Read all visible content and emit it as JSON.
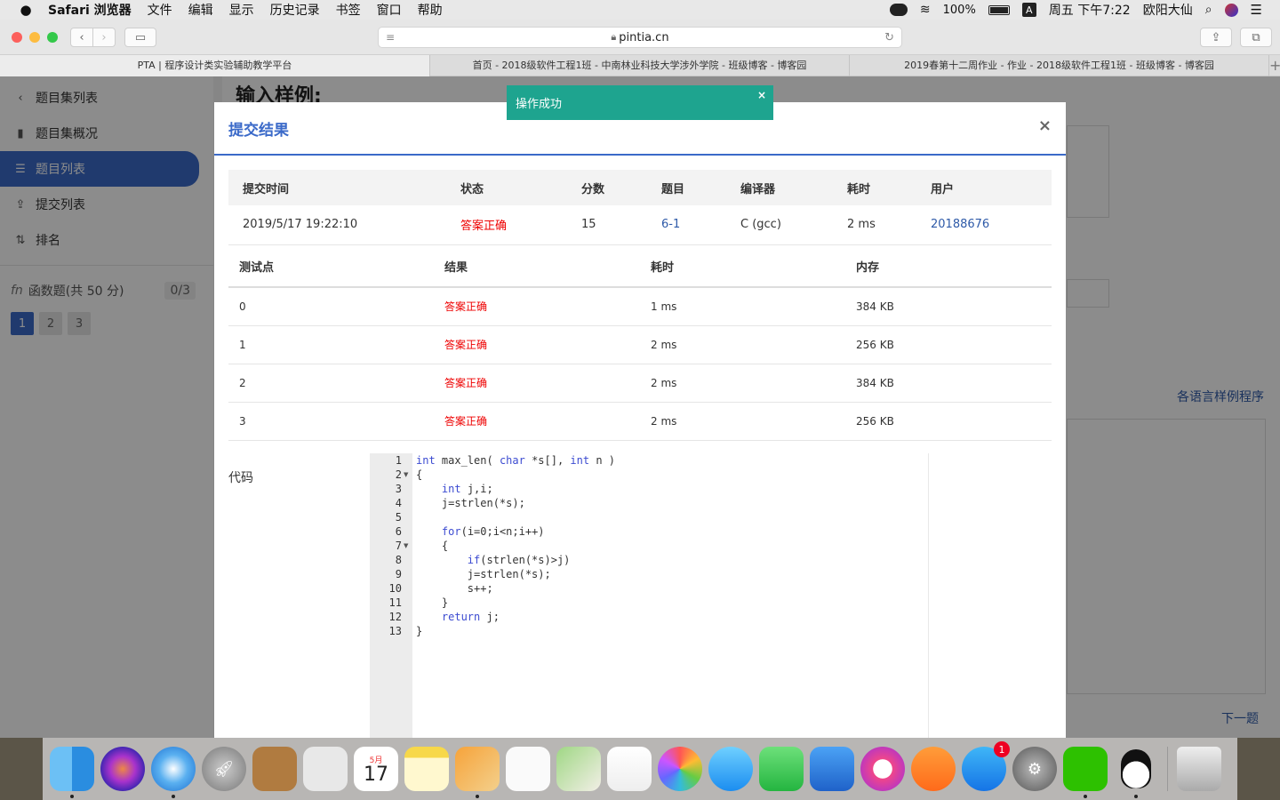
{
  "menubar": {
    "app": "Safari 浏览器",
    "items": [
      "文件",
      "编辑",
      "显示",
      "历史记录",
      "书签",
      "窗口",
      "帮助"
    ],
    "battery": "100%",
    "input_method": "A",
    "clock": "周五 下午7:22",
    "user": "欧阳大仙"
  },
  "toolbar": {
    "url": "pintia.cn"
  },
  "tabs": [
    "PTA | 程序设计类实验辅助教学平台",
    "首页 - 2018级软件工程1班 - 中南林业科技大学涉外学院 - 班级博客 - 博客园",
    "2019春第十二周作业 - 作业 - 2018级软件工程1班 - 班级博客 - 博客园"
  ],
  "sidebar": {
    "back": "题目集列表",
    "items": [
      "题目集概况",
      "题目列表",
      "提交列表",
      "排名"
    ],
    "group_label": "函数题(共 50 分)",
    "group_count": "0/3",
    "pages": [
      "1",
      "2",
      "3"
    ]
  },
  "background": {
    "title": "输入样例:",
    "sample_link": "各语言样例程序",
    "next_link": "下一题"
  },
  "toast": {
    "message": "操作成功",
    "close": "×"
  },
  "modal": {
    "title": "提交结果",
    "close": "×",
    "summary_headers": [
      "提交时间",
      "状态",
      "分数",
      "题目",
      "编译器",
      "耗时",
      "用户"
    ],
    "summary": {
      "time": "2019/5/17 19:22:10",
      "status": "答案正确",
      "score": "15",
      "problem": "6-1",
      "compiler": "C (gcc)",
      "elapsed": "2 ms",
      "user": "20188676"
    },
    "case_headers": [
      "测试点",
      "结果",
      "耗时",
      "内存"
    ],
    "cases": [
      {
        "id": "0",
        "result": "答案正确",
        "time": "1 ms",
        "memory": "384 KB"
      },
      {
        "id": "1",
        "result": "答案正确",
        "time": "2 ms",
        "memory": "256 KB"
      },
      {
        "id": "2",
        "result": "答案正确",
        "time": "2 ms",
        "memory": "384 KB"
      },
      {
        "id": "3",
        "result": "答案正确",
        "time": "2 ms",
        "memory": "256 KB"
      }
    ],
    "code_label": "代码",
    "code_lines": [
      "int max_len( char *s[], int n )",
      "{",
      "    int j,i;",
      "    j=strlen(*s);",
      "",
      "    for(i=0;i<n;i++)",
      "    {",
      "        if(strlen(*s)>j)",
      "        j=strlen(*s);",
      "        s++;",
      "    }",
      "    return j;",
      "}"
    ]
  },
  "dock": {
    "apps": [
      "finder-icon",
      "siri-icon",
      "safari-icon",
      "launchpad-icon",
      "contacts-icon",
      "preview-icon",
      "calendar-icon",
      "notes-icon",
      "pages-icon",
      "reminders-icon",
      "maps-icon",
      "numbers-icon",
      "photos-icon",
      "messages-icon",
      "facetime-icon",
      "keynote-icon",
      "music-icon",
      "books-icon",
      "appstore-icon",
      "system-preferences-icon",
      "wechat-icon",
      "qq-icon",
      "trash-icon"
    ],
    "calendar_month": "5月",
    "calendar_day": "17",
    "appstore_badge": "1"
  }
}
